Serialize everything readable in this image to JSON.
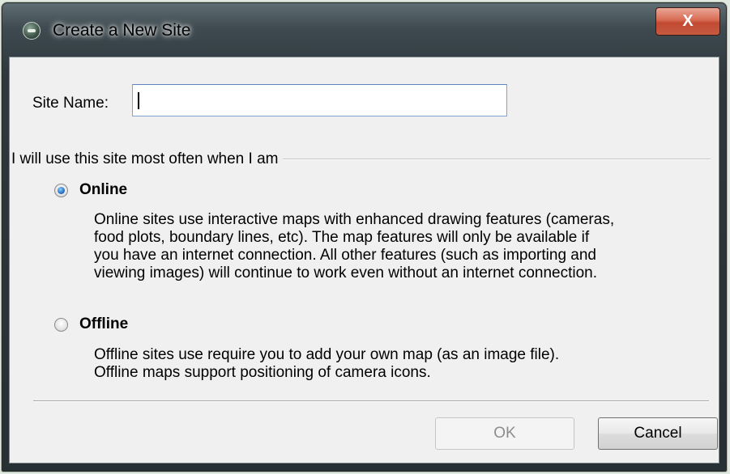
{
  "window": {
    "title": "Create a New Site",
    "close_label": "X"
  },
  "form": {
    "site_name_label": "Site Name:",
    "site_name_value": "",
    "group_label": "I will use this site most often when I am",
    "selected_option": "Online"
  },
  "options": [
    {
      "label": "Online",
      "checked": true,
      "description": [
        "Online sites use interactive maps with enhanced drawing features (cameras,",
        "food plots, boundary lines, etc). The map features will only be available if",
        "you have an internet connection. All other features (such as importing and",
        "viewing images) will continue to work even without an internet connection."
      ]
    },
    {
      "label": "Offline",
      "checked": false,
      "description": [
        "Offline sites use require you to add your own map (as an image file).",
        "Offline maps support positioning of camera icons."
      ]
    }
  ],
  "buttons": {
    "ok_label": "OK",
    "ok_enabled": false,
    "cancel_label": "Cancel"
  },
  "icons": {
    "app": "app-logo-icon",
    "close": "close-icon",
    "radio_on": "radio-checked-icon",
    "radio_off": "radio-unchecked-icon"
  },
  "colors": {
    "titlebar": "#3f4b51",
    "close_button": "#c55a40",
    "client_bg": "#f0f0f0",
    "radio_accent": "#2d78c8",
    "disabled_text": "#8d8d8d"
  }
}
